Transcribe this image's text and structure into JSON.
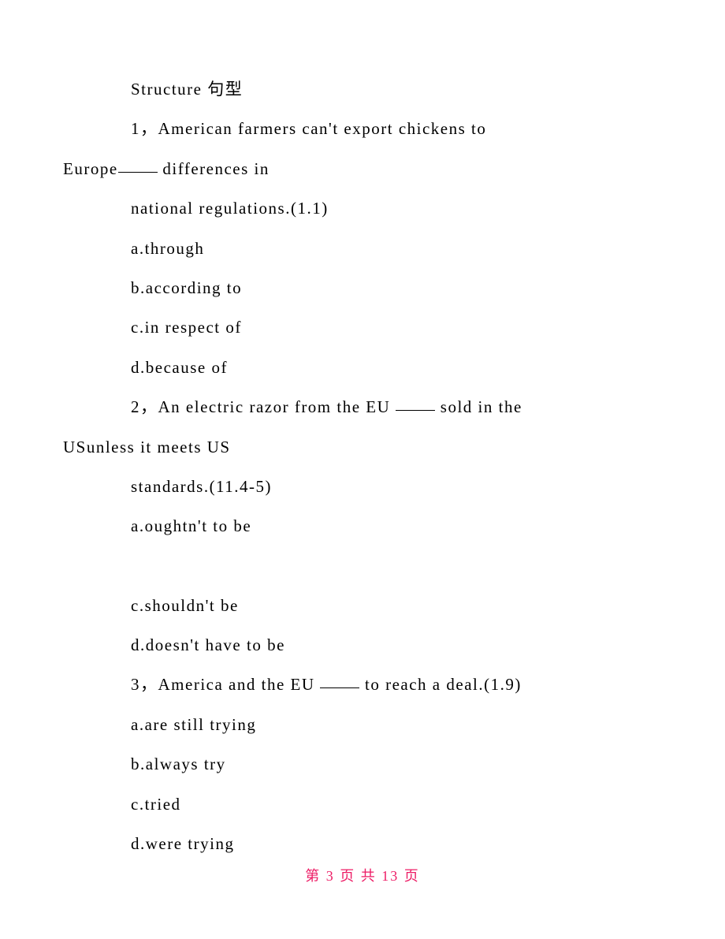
{
  "section_title": "Structure 句型",
  "questions": [
    {
      "number": "1",
      "stem_part1": "American farmers can't export chickens to",
      "stem_line2_before_blank": "Europe",
      "stem_line2_after_blank": " differences in",
      "stem_line3": "national regulations.(1.1)",
      "options": [
        {
          "letter": "a",
          "text": "through"
        },
        {
          "letter": "b",
          "text": "according to"
        },
        {
          "letter": "c",
          "text": "in respect of"
        },
        {
          "letter": "d",
          "text": "because of"
        }
      ]
    },
    {
      "number": "2",
      "stem_before_blank": "An electric razor from the EU ",
      "stem_after_blank": " sold in the",
      "stem_line2": "USunless it meets US",
      "stem_line3": "standards.(11.4-5)",
      "options": [
        {
          "letter": "a",
          "text": "oughtn't to be"
        },
        {
          "letter": "c",
          "text": "shouldn't be"
        },
        {
          "letter": "d",
          "text": "doesn't have to be"
        }
      ]
    },
    {
      "number": "3",
      "stem_before_blank": "America and the EU ",
      "stem_after_blank": " to reach a deal.(1.9)",
      "options": [
        {
          "letter": "a",
          "text": "are still trying"
        },
        {
          "letter": "b",
          "text": "always try"
        },
        {
          "letter": "c",
          "text": "tried"
        },
        {
          "letter": "d",
          "text": "were trying"
        }
      ]
    }
  ],
  "footer": {
    "prefix": "第 ",
    "current": "3",
    "mid": " 页 共 ",
    "total": "13",
    "suffix": " 页"
  }
}
